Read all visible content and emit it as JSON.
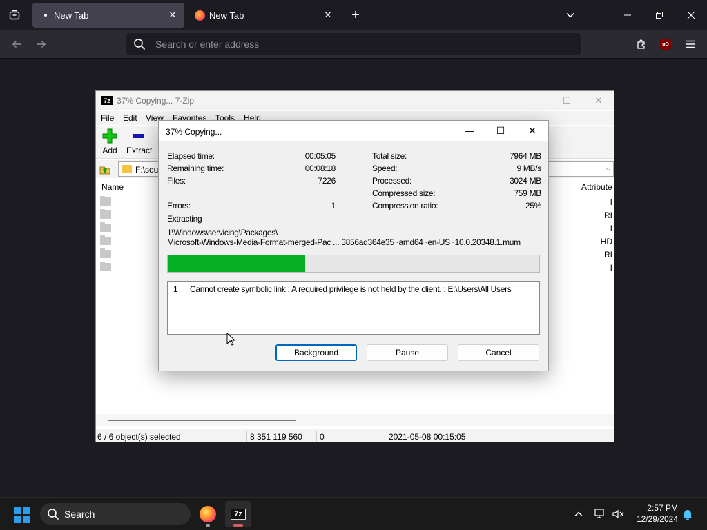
{
  "browser": {
    "tabs": [
      {
        "label": "New Tab",
        "active": true
      },
      {
        "label": "New Tab",
        "active": false
      }
    ],
    "url_placeholder": "Search or enter address"
  },
  "zip": {
    "title": "37% Copying... 7-Zip",
    "app_icon": "7z",
    "menu": [
      "File",
      "Edit",
      "View",
      "Favorites",
      "Tools",
      "Help"
    ],
    "toolbar": {
      "add_label": "Add",
      "extract_label": "Extract"
    },
    "address": "F:\\sou",
    "columns": {
      "name": "Name",
      "attributes": "Attribute"
    },
    "rows": [
      {
        "attr": "I"
      },
      {
        "attr": "RI"
      },
      {
        "attr": "I"
      },
      {
        "attr": "HD"
      },
      {
        "attr": "RI"
      },
      {
        "attr": "I"
      }
    ],
    "status": {
      "selected": "6 / 6 object(s) selected",
      "size": "8 351 119 560",
      "packed": "0",
      "modified": "2021-05-08 00:15:05"
    }
  },
  "dialog": {
    "title": "37% Copying...",
    "left_stats": [
      {
        "label": "Elapsed time:",
        "value": "00:05:05"
      },
      {
        "label": "Remaining time:",
        "value": "00:08:18"
      },
      {
        "label": "Files:",
        "value": "7226"
      },
      {
        "label": "Errors:",
        "value": "1"
      }
    ],
    "right_stats": [
      {
        "label": "Total size:",
        "value": "7964 MB"
      },
      {
        "label": "Speed:",
        "value": "9 MB/s"
      },
      {
        "label": "Processed:",
        "value": "3024 MB"
      },
      {
        "label": "Compressed size:",
        "value": "759 MB"
      },
      {
        "label": "Compression ratio:",
        "value": "25%"
      }
    ],
    "operation": "Extracting",
    "path_line1": "1\\Windows\\servicing\\Packages\\",
    "path_line2": "Microsoft-Windows-Media-Format-merged-Pac ... 3856ad364e35~amd64~en-US~10.0.20348.1.mum",
    "progress_fraction": 0.37,
    "errors": [
      {
        "index": "1",
        "message": "Cannot create symbolic link : A required privilege is not held by the client. : E:\\Users\\All Users"
      }
    ],
    "buttons": {
      "background": "Background",
      "pause": "Pause",
      "cancel": "Cancel"
    }
  },
  "taskbar": {
    "search_label": "Search",
    "time": "2:57 PM",
    "date": "12/29/2024"
  },
  "colors": {
    "progress_fill": "#06b025",
    "browser_bg": "#1c1b22",
    "taskbar_bg": "#1a1a1a",
    "accent": "#0067c0"
  }
}
